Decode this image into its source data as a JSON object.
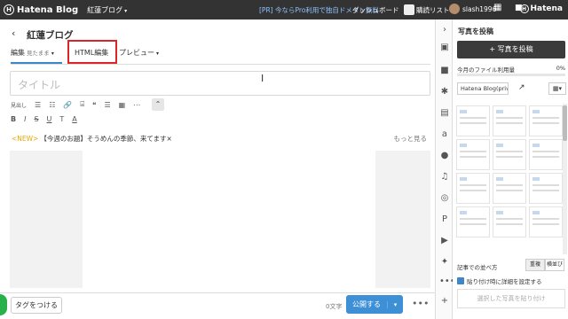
{
  "topbar": {
    "logo_text": "Hatena Blog",
    "blog_name": "紅蓮ブログ",
    "promo": "[PR] 今ならPro利用で独自ドメイン無料",
    "dashboard": "ダッシュボード",
    "reading_list": "購読リスト",
    "username": "slash1996",
    "brand": "Hatena"
  },
  "editor": {
    "back_glyph": "‹",
    "blog_title": "紅蓮ブログ",
    "tabs": [
      {
        "label": "編集",
        "sub": "見たまま"
      },
      {
        "label": "HTML編集"
      },
      {
        "label": "プレビュー"
      }
    ],
    "title_placeholder": "タイトル",
    "toolbar_row1": [
      "見出し",
      "☰",
      "☷",
      "🔗",
      "⌸",
      "❝",
      "☰",
      "▦",
      "⋯"
    ],
    "toolbar_row2": [
      "B",
      "I",
      "S",
      "U",
      "T",
      "A"
    ],
    "news_tag": "<NEW>",
    "news_text": "【今週のお題】そうめんの季節、来てます",
    "news_close": "×",
    "news_more": "もっと見る",
    "tag_button": "タグをつける",
    "char_count": "0文字",
    "publish_label": "公開する",
    "more": "•••"
  },
  "panel": {
    "title": "写真を投稿",
    "upload_button": "+ 写真を投稿",
    "quota_label": "今月のファイル利用量",
    "quota_percent": "0%",
    "quota_fill": 0,
    "album": "Hatena Blog(private)",
    "sort_label": "記事での並べ方",
    "sort_options": [
      "重複",
      "横並び"
    ],
    "checkbox_label": "貼り付け時に詳細を設定する",
    "paste_button": "選択した写真を貼り付け"
  },
  "colors": {
    "topbar": "#333333",
    "accent": "#3d8fd6",
    "highlight": "#d9262b",
    "news_tag": "#e8a800"
  }
}
